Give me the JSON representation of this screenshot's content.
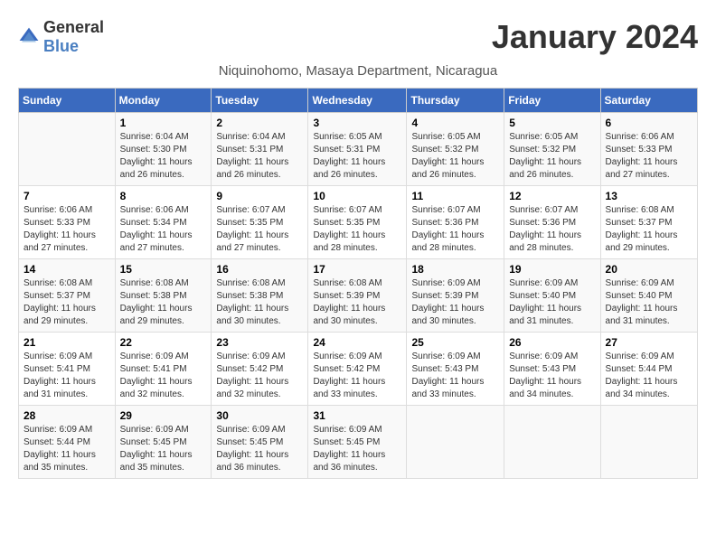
{
  "app": {
    "name_general": "General",
    "name_blue": "Blue"
  },
  "header": {
    "month_title": "January 2024",
    "location": "Niquinohomo, Masaya Department, Nicaragua"
  },
  "weekdays": [
    "Sunday",
    "Monday",
    "Tuesday",
    "Wednesday",
    "Thursday",
    "Friday",
    "Saturday"
  ],
  "weeks": [
    [
      {
        "day": "",
        "sunrise": "",
        "sunset": "",
        "daylight": ""
      },
      {
        "day": "1",
        "sunrise": "Sunrise: 6:04 AM",
        "sunset": "Sunset: 5:30 PM",
        "daylight": "Daylight: 11 hours and 26 minutes."
      },
      {
        "day": "2",
        "sunrise": "Sunrise: 6:04 AM",
        "sunset": "Sunset: 5:31 PM",
        "daylight": "Daylight: 11 hours and 26 minutes."
      },
      {
        "day": "3",
        "sunrise": "Sunrise: 6:05 AM",
        "sunset": "Sunset: 5:31 PM",
        "daylight": "Daylight: 11 hours and 26 minutes."
      },
      {
        "day": "4",
        "sunrise": "Sunrise: 6:05 AM",
        "sunset": "Sunset: 5:32 PM",
        "daylight": "Daylight: 11 hours and 26 minutes."
      },
      {
        "day": "5",
        "sunrise": "Sunrise: 6:05 AM",
        "sunset": "Sunset: 5:32 PM",
        "daylight": "Daylight: 11 hours and 26 minutes."
      },
      {
        "day": "6",
        "sunrise": "Sunrise: 6:06 AM",
        "sunset": "Sunset: 5:33 PM",
        "daylight": "Daylight: 11 hours and 27 minutes."
      }
    ],
    [
      {
        "day": "7",
        "sunrise": "Sunrise: 6:06 AM",
        "sunset": "Sunset: 5:33 PM",
        "daylight": "Daylight: 11 hours and 27 minutes."
      },
      {
        "day": "8",
        "sunrise": "Sunrise: 6:06 AM",
        "sunset": "Sunset: 5:34 PM",
        "daylight": "Daylight: 11 hours and 27 minutes."
      },
      {
        "day": "9",
        "sunrise": "Sunrise: 6:07 AM",
        "sunset": "Sunset: 5:35 PM",
        "daylight": "Daylight: 11 hours and 27 minutes."
      },
      {
        "day": "10",
        "sunrise": "Sunrise: 6:07 AM",
        "sunset": "Sunset: 5:35 PM",
        "daylight": "Daylight: 11 hours and 28 minutes."
      },
      {
        "day": "11",
        "sunrise": "Sunrise: 6:07 AM",
        "sunset": "Sunset: 5:36 PM",
        "daylight": "Daylight: 11 hours and 28 minutes."
      },
      {
        "day": "12",
        "sunrise": "Sunrise: 6:07 AM",
        "sunset": "Sunset: 5:36 PM",
        "daylight": "Daylight: 11 hours and 28 minutes."
      },
      {
        "day": "13",
        "sunrise": "Sunrise: 6:08 AM",
        "sunset": "Sunset: 5:37 PM",
        "daylight": "Daylight: 11 hours and 29 minutes."
      }
    ],
    [
      {
        "day": "14",
        "sunrise": "Sunrise: 6:08 AM",
        "sunset": "Sunset: 5:37 PM",
        "daylight": "Daylight: 11 hours and 29 minutes."
      },
      {
        "day": "15",
        "sunrise": "Sunrise: 6:08 AM",
        "sunset": "Sunset: 5:38 PM",
        "daylight": "Daylight: 11 hours and 29 minutes."
      },
      {
        "day": "16",
        "sunrise": "Sunrise: 6:08 AM",
        "sunset": "Sunset: 5:38 PM",
        "daylight": "Daylight: 11 hours and 30 minutes."
      },
      {
        "day": "17",
        "sunrise": "Sunrise: 6:08 AM",
        "sunset": "Sunset: 5:39 PM",
        "daylight": "Daylight: 11 hours and 30 minutes."
      },
      {
        "day": "18",
        "sunrise": "Sunrise: 6:09 AM",
        "sunset": "Sunset: 5:39 PM",
        "daylight": "Daylight: 11 hours and 30 minutes."
      },
      {
        "day": "19",
        "sunrise": "Sunrise: 6:09 AM",
        "sunset": "Sunset: 5:40 PM",
        "daylight": "Daylight: 11 hours and 31 minutes."
      },
      {
        "day": "20",
        "sunrise": "Sunrise: 6:09 AM",
        "sunset": "Sunset: 5:40 PM",
        "daylight": "Daylight: 11 hours and 31 minutes."
      }
    ],
    [
      {
        "day": "21",
        "sunrise": "Sunrise: 6:09 AM",
        "sunset": "Sunset: 5:41 PM",
        "daylight": "Daylight: 11 hours and 31 minutes."
      },
      {
        "day": "22",
        "sunrise": "Sunrise: 6:09 AM",
        "sunset": "Sunset: 5:41 PM",
        "daylight": "Daylight: 11 hours and 32 minutes."
      },
      {
        "day": "23",
        "sunrise": "Sunrise: 6:09 AM",
        "sunset": "Sunset: 5:42 PM",
        "daylight": "Daylight: 11 hours and 32 minutes."
      },
      {
        "day": "24",
        "sunrise": "Sunrise: 6:09 AM",
        "sunset": "Sunset: 5:42 PM",
        "daylight": "Daylight: 11 hours and 33 minutes."
      },
      {
        "day": "25",
        "sunrise": "Sunrise: 6:09 AM",
        "sunset": "Sunset: 5:43 PM",
        "daylight": "Daylight: 11 hours and 33 minutes."
      },
      {
        "day": "26",
        "sunrise": "Sunrise: 6:09 AM",
        "sunset": "Sunset: 5:43 PM",
        "daylight": "Daylight: 11 hours and 34 minutes."
      },
      {
        "day": "27",
        "sunrise": "Sunrise: 6:09 AM",
        "sunset": "Sunset: 5:44 PM",
        "daylight": "Daylight: 11 hours and 34 minutes."
      }
    ],
    [
      {
        "day": "28",
        "sunrise": "Sunrise: 6:09 AM",
        "sunset": "Sunset: 5:44 PM",
        "daylight": "Daylight: 11 hours and 35 minutes."
      },
      {
        "day": "29",
        "sunrise": "Sunrise: 6:09 AM",
        "sunset": "Sunset: 5:45 PM",
        "daylight": "Daylight: 11 hours and 35 minutes."
      },
      {
        "day": "30",
        "sunrise": "Sunrise: 6:09 AM",
        "sunset": "Sunset: 5:45 PM",
        "daylight": "Daylight: 11 hours and 36 minutes."
      },
      {
        "day": "31",
        "sunrise": "Sunrise: 6:09 AM",
        "sunset": "Sunset: 5:45 PM",
        "daylight": "Daylight: 11 hours and 36 minutes."
      },
      {
        "day": "",
        "sunrise": "",
        "sunset": "",
        "daylight": ""
      },
      {
        "day": "",
        "sunrise": "",
        "sunset": "",
        "daylight": ""
      },
      {
        "day": "",
        "sunrise": "",
        "sunset": "",
        "daylight": ""
      }
    ]
  ]
}
